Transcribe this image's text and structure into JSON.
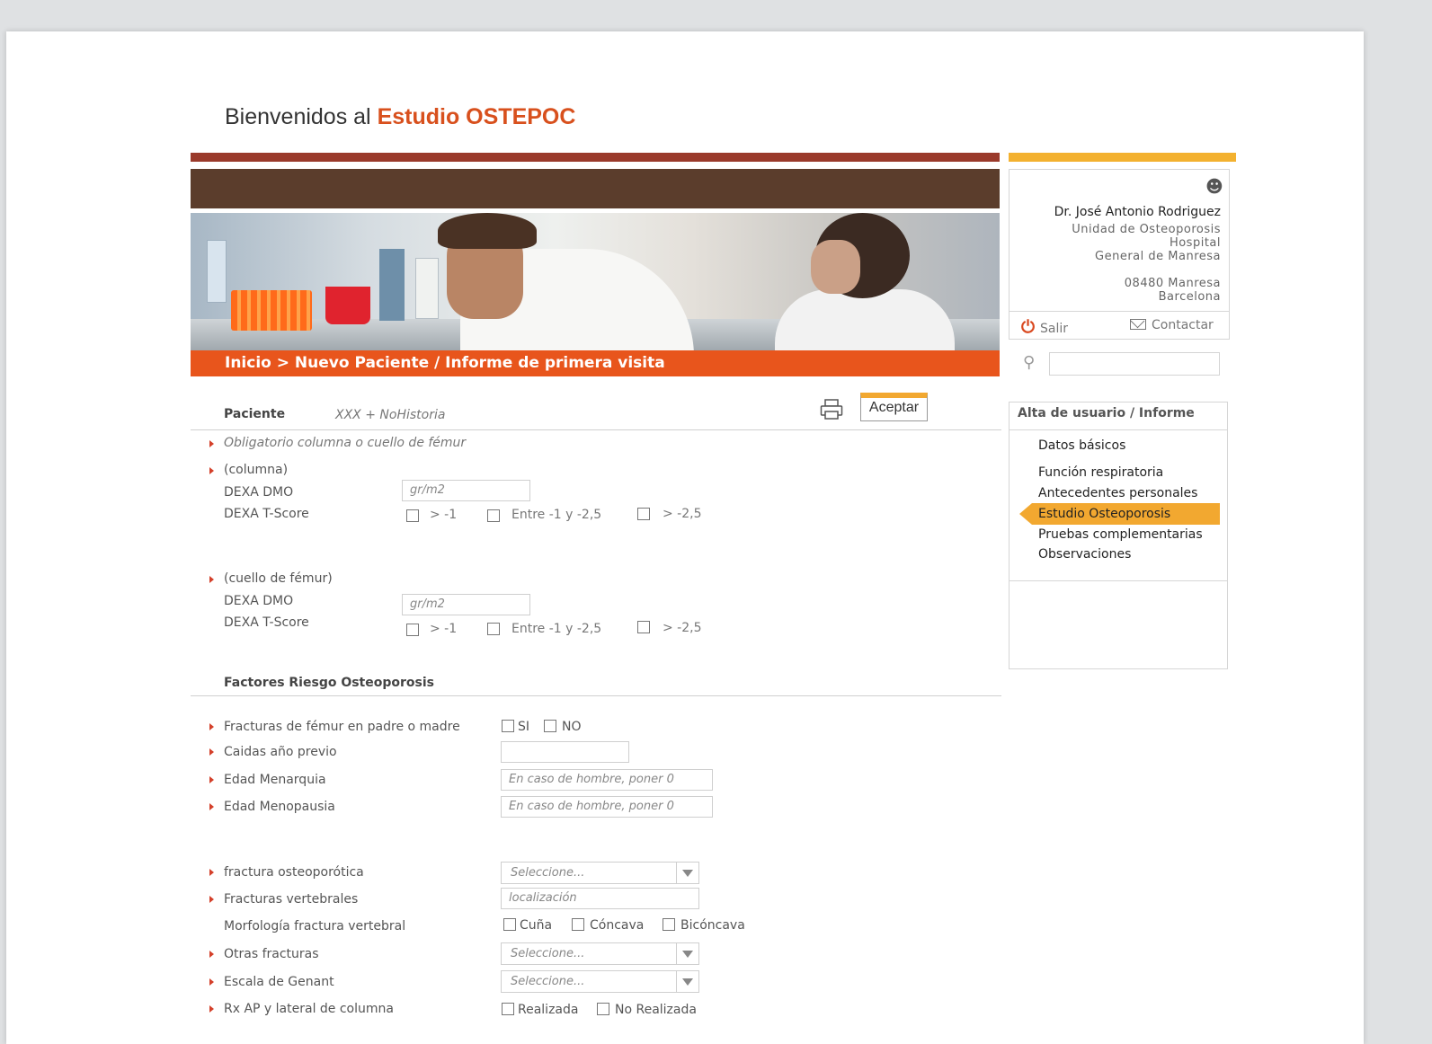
{
  "header": {
    "welcome_prefix": "Bienvenidos al",
    "brand": "Estudio OSTEPOC"
  },
  "breadcrumb": "Inicio > Nuevo Paciente / Informe de primera visita",
  "user": {
    "name": "Dr. José Antonio Rodriguez",
    "unit": "Unidad de Osteoporosis",
    "hospital_line1": "Hospital",
    "hospital_line2": "General de Manresa",
    "postal": "08480 Manresa",
    "city": "Barcelona",
    "logout_label": "Salir",
    "contact_label": "Contactar"
  },
  "search": {
    "placeholder": ""
  },
  "nav": {
    "title": "Alta de usuario / Informe",
    "items": [
      "Datos básicos",
      "Función respiratoria",
      "Antecedentes personales",
      "Estudio Osteoporosis",
      "Pruebas complementarias",
      "Observaciones"
    ],
    "active_index": 3
  },
  "toolbar": {
    "accept_label": "Aceptar"
  },
  "patient": {
    "label": "Paciente",
    "value": "XXX + NoHistoria"
  },
  "dexa": {
    "note": "Obligatorio columna o cuello de fémur",
    "columna_label": "(columna)",
    "femur_label": "(cuello de fémur)",
    "dmo_label": "DEXA DMO",
    "tscore_label": "DEXA T-Score",
    "dmo_placeholder": "gr/m2",
    "opt1": "> -1",
    "opt2": "Entre -1 y -2,5",
    "opt3": "> -2,5"
  },
  "risk": {
    "title": "Factores Riesgo Osteoporosis",
    "parent_fracture_label": "Fracturas de fémur en padre o madre",
    "yes": "SI",
    "no": "NO",
    "falls_label": "Caidas año previo",
    "menarche_label": "Edad Menarquia",
    "menopause_label": "Edad Menopausia",
    "male_hint": "En caso de hombre, poner 0",
    "osteo_fracture_label": "fractura osteoporótica",
    "select_placeholder": "Seleccione...",
    "vertebral_label": "Fracturas vertebrales",
    "vertebral_placeholder": "localización",
    "morphology_label": "Morfología fractura vertebral",
    "morph_1": "Cuña",
    "morph_2": "Cóncava",
    "morph_3": "Bicóncava",
    "other_label": "Otras fracturas",
    "genant_label": "Escala de Genant",
    "rx_label": "Rx AP y lateral de columna",
    "rx_done": "Realizada",
    "rx_not_done": "No Realizada"
  }
}
